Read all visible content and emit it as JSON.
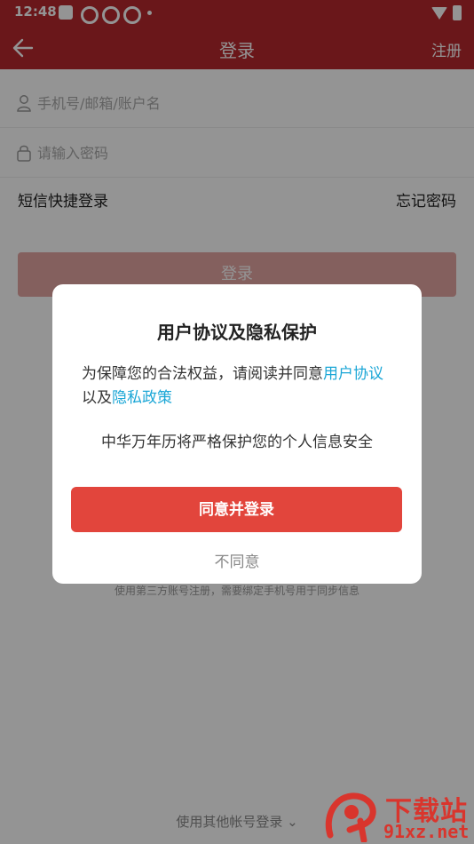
{
  "status_bar": {
    "time": "12:48"
  },
  "nav": {
    "title": "登录",
    "register": "注册"
  },
  "form": {
    "account_placeholder": "手机号/邮箱/账户名",
    "password_placeholder": "请输入密码",
    "sms_login": "短信快捷登录",
    "forgot_password": "忘记密码",
    "login_button": "登录",
    "third_party_note": "使用第三方账号注册，需要绑定手机号用于同步信息",
    "other_login": "使用其他帐号登录 ⌄"
  },
  "dialog": {
    "title": "用户协议及隐私保护",
    "body_prefix": "为保障您的合法权益，请阅读并同意",
    "user_agreement": "用户协议",
    "body_mid": "以及",
    "privacy_policy": "隐私政策",
    "note": "中华万年历将严格保护您的个人信息安全",
    "agree_button": "同意并登录",
    "disagree_button": "不同意"
  },
  "watermark": {
    "top": "下载站",
    "bottom": "91xz.net"
  },
  "colors": {
    "brand": "#b7282d",
    "accent": "#e2453c",
    "link": "#1aa6d6"
  },
  "icons": [
    "back-arrow-icon",
    "user-icon",
    "lock-icon",
    "wifi-icon",
    "battery-icon"
  ]
}
